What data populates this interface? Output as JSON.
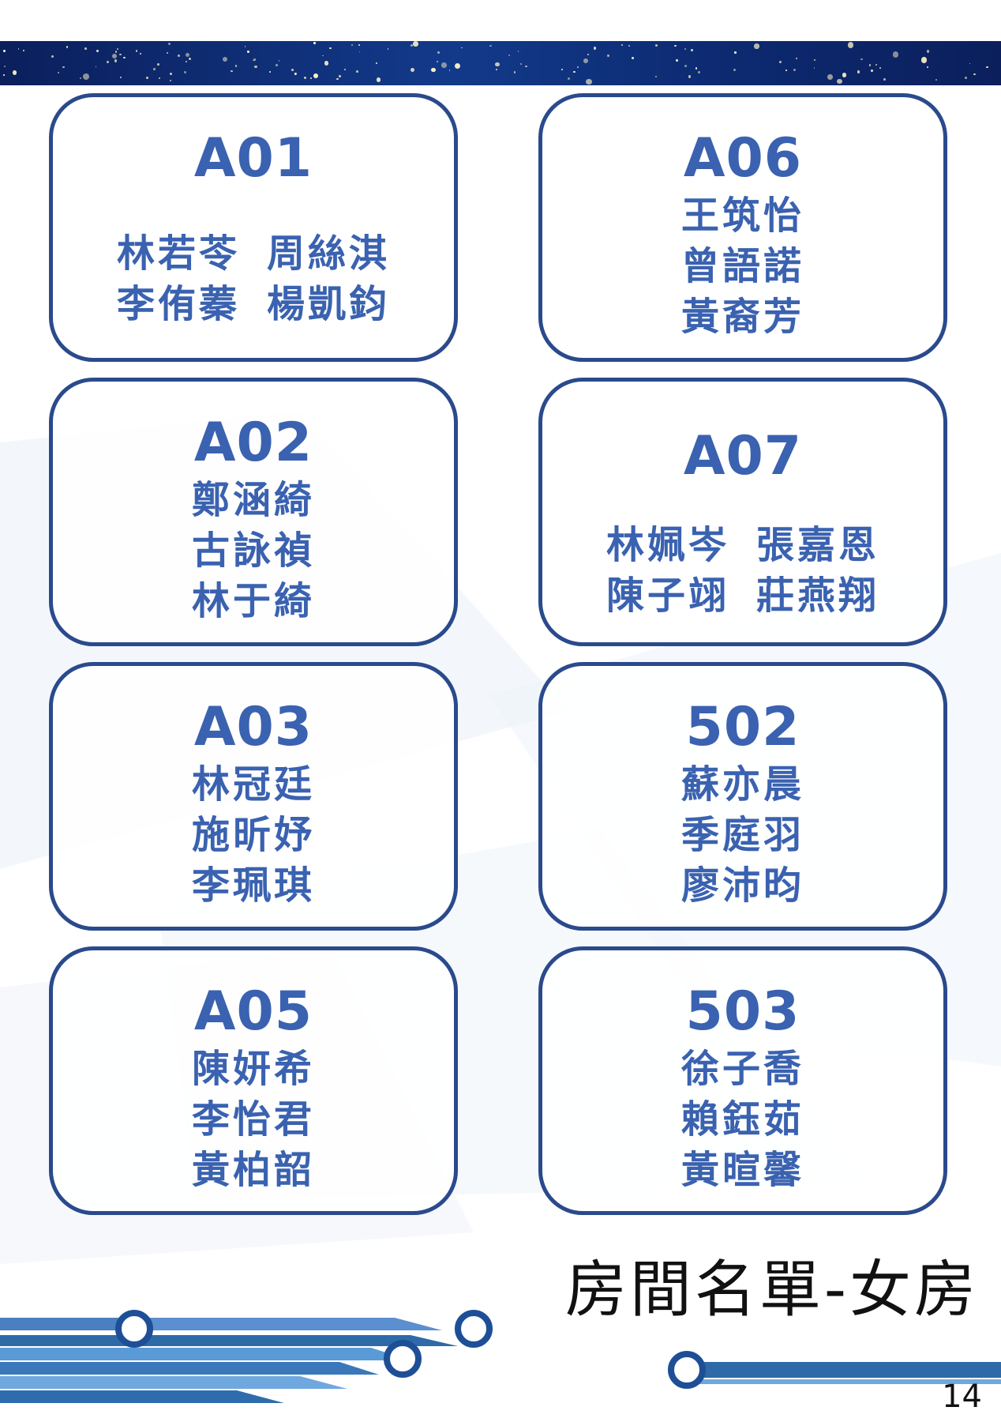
{
  "page": {
    "title": "房間名單-女房",
    "number": "14"
  },
  "colors": {
    "accent": "#3a62b0",
    "border": "#2a4a8c",
    "band": "#123a8a"
  },
  "rooms": [
    {
      "code": "A01",
      "pairs": [
        [
          "林若苓",
          "周絲淇"
        ],
        [
          "李侑蓁",
          "楊凱鈞"
        ]
      ]
    },
    {
      "code": "A06",
      "names": [
        "王筑怡",
        "曾語諾",
        "黃裔芳"
      ]
    },
    {
      "code": "A02",
      "names": [
        "鄭涵綺",
        "古詠禎",
        "林于綺"
      ]
    },
    {
      "code": "A07",
      "pairs": [
        [
          "林姵岑",
          "張嘉恩"
        ],
        [
          "陳子翊",
          "莊燕翔"
        ]
      ]
    },
    {
      "code": "A03",
      "names": [
        "林冠廷",
        "施昕妤",
        "李珮琪"
      ]
    },
    {
      "code": "502",
      "names": [
        "蘇亦晨",
        "季庭羽",
        "廖沛昀"
      ]
    },
    {
      "code": "A05",
      "names": [
        "陳妍希",
        "李怡君",
        "黃柏韶"
      ]
    },
    {
      "code": "503",
      "names": [
        "徐子喬",
        "賴鈺茹",
        "黃暄馨"
      ]
    }
  ]
}
